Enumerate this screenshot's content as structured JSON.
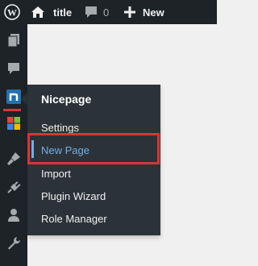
{
  "admin_bar": {
    "wp_logo_icon": "wordpress-logo-icon",
    "home_icon": "home-icon",
    "site_title": "title",
    "comments_icon": "comment-bubble-icon",
    "comment_count": "0",
    "new_icon": "plus-icon",
    "new_label": "New"
  },
  "sidebar": {
    "icons": [
      "pages-icon",
      "comments-icon",
      "nicepage-icon",
      "color-grid-icon",
      "appearance-brush-icon",
      "plugins-icon",
      "users-icon",
      "tools-wrench-icon"
    ]
  },
  "flyout": {
    "title": "Nicepage",
    "items": [
      {
        "label": "Settings"
      },
      {
        "label": "New Page",
        "current": true
      },
      {
        "label": "Import"
      },
      {
        "label": "Plugin Wizard"
      },
      {
        "label": "Role Manager"
      }
    ]
  },
  "colors": {
    "admin_bar_bg": "#1d2327",
    "flyout_bg": "#2c3338",
    "accent_blue": "#72aee6",
    "highlight_red": "#d63638",
    "nicepage_blue": "#2271b1"
  }
}
